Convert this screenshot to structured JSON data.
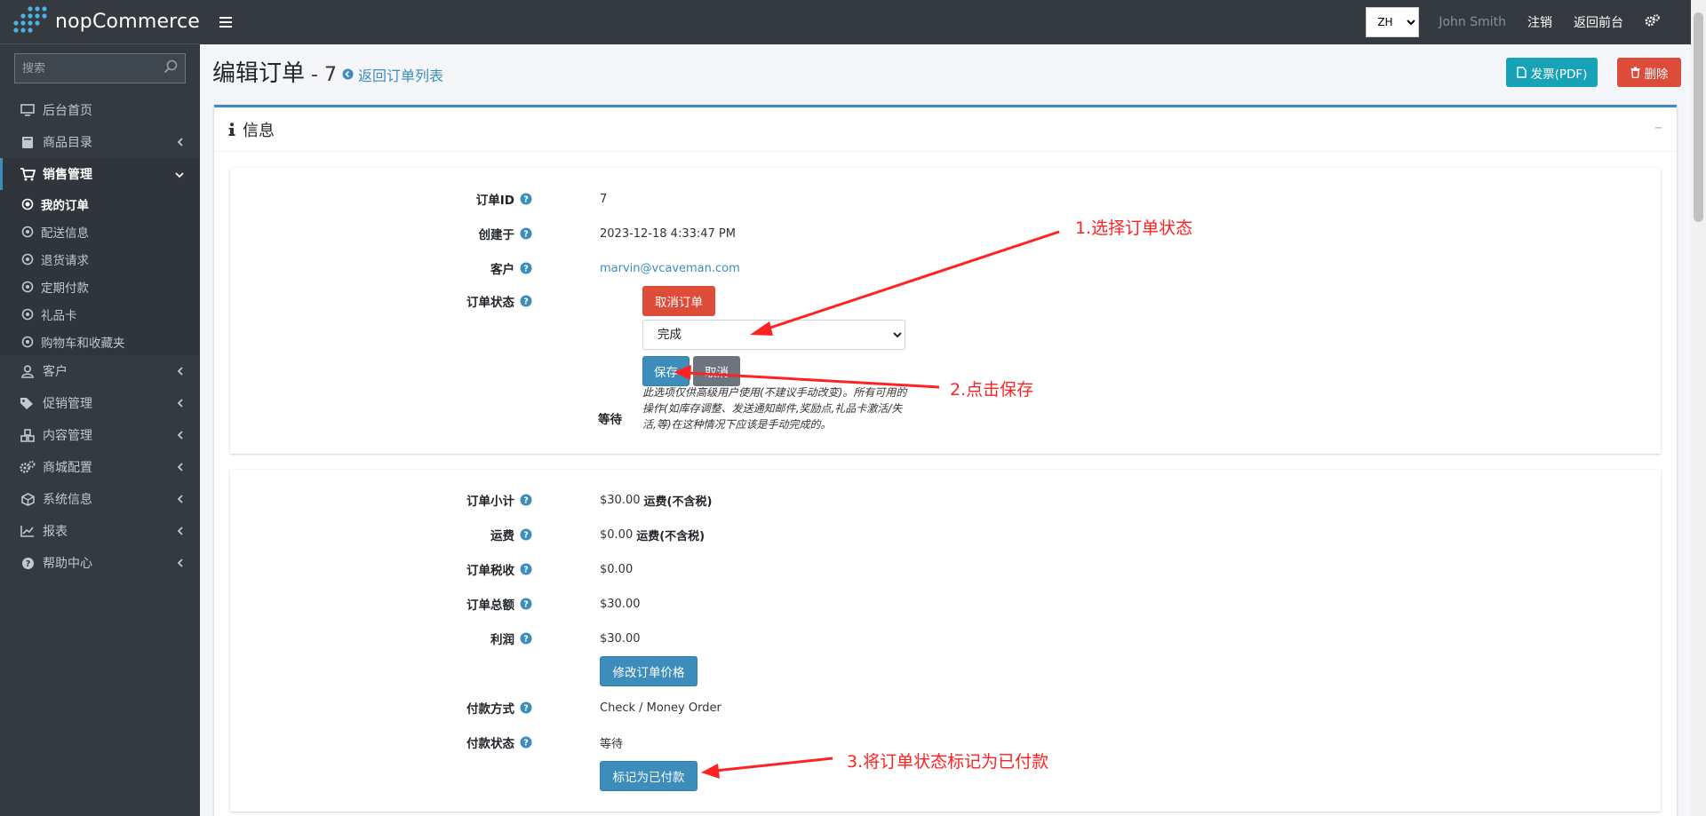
{
  "brand": {
    "name": "nopCommerce"
  },
  "search": {
    "placeholder": "搜索"
  },
  "sidebar": {
    "items": [
      {
        "label": "后台首页",
        "icon": "desktop-icon"
      },
      {
        "label": "商品目录",
        "icon": "book-icon"
      },
      {
        "label": "销售管理",
        "icon": "cart-icon",
        "expanded": true
      },
      {
        "label": "客户",
        "icon": "user-icon"
      },
      {
        "label": "促销管理",
        "icon": "tags-icon"
      },
      {
        "label": "内容管理",
        "icon": "cubes-icon"
      },
      {
        "label": "商城配置",
        "icon": "gears-icon"
      },
      {
        "label": "系统信息",
        "icon": "cube-icon"
      },
      {
        "label": "报表",
        "icon": "chart-icon"
      },
      {
        "label": "帮助中心",
        "icon": "question-icon"
      }
    ],
    "sales_sub": [
      {
        "label": "我的订单",
        "current": true
      },
      {
        "label": "配送信息"
      },
      {
        "label": "退货请求"
      },
      {
        "label": "定期付款"
      },
      {
        "label": "礼品卡"
      },
      {
        "label": "购物车和收藏夹"
      }
    ]
  },
  "topbar": {
    "language": "ZH",
    "user": "John Smith",
    "logout": "注销",
    "public_store": "返回前台"
  },
  "page": {
    "title": "编辑订单",
    "order_suffix": " - 7",
    "back_link": "返回订单列表",
    "invoice_button": "发票(PDF)",
    "delete_button": "删除"
  },
  "card": {
    "title": "信息"
  },
  "info": {
    "order_id_label": "订单ID",
    "order_id": "7",
    "created_label": "创建于",
    "created": "2023-12-18 4:33:47 PM",
    "customer_label": "客户",
    "customer": "marvin@vcaveman.com",
    "status_label": "订单状态",
    "cancel_order_button": "取消订单",
    "status_selected": "完成",
    "save_button": "保存",
    "cancel_button": "取消",
    "note": "此选项仅供高级用户使用(不建议手动改变)。所有可用的操作(如库存调整、发送通知邮件,奖励点,礼品卡激活/失活,等)在这种情况下应该是手动完成的。",
    "current_status": "等待"
  },
  "totals": {
    "subtotal_label": "订单小计",
    "subtotal": "$30.00",
    "subtotal_suffix": "运费(不含税)",
    "shipping_label": "运费",
    "shipping": "$0.00",
    "shipping_suffix": "运费(不含税)",
    "tax_label": "订单税收",
    "tax": "$0.00",
    "total_label": "订单总额",
    "total": "$30.00",
    "profit_label": "利润",
    "profit": "$30.00",
    "edit_totals_button": "修改订单价格",
    "payment_method_label": "付款方式",
    "payment_method": "Check / Money Order",
    "payment_status_label": "付款状态",
    "payment_status": "等待",
    "mark_paid_button": "标记为已付款"
  },
  "annotations": {
    "step1": "1.选择订单状态",
    "step2": "2.点击保存",
    "step3": "3.将订单状态标记为已付款"
  },
  "colors": {
    "sidebar_bg": "#343a40",
    "primary": "#3c8dbc",
    "danger": "#dd4b39",
    "info": "#17a2b8",
    "annotation": "#ff2222"
  }
}
